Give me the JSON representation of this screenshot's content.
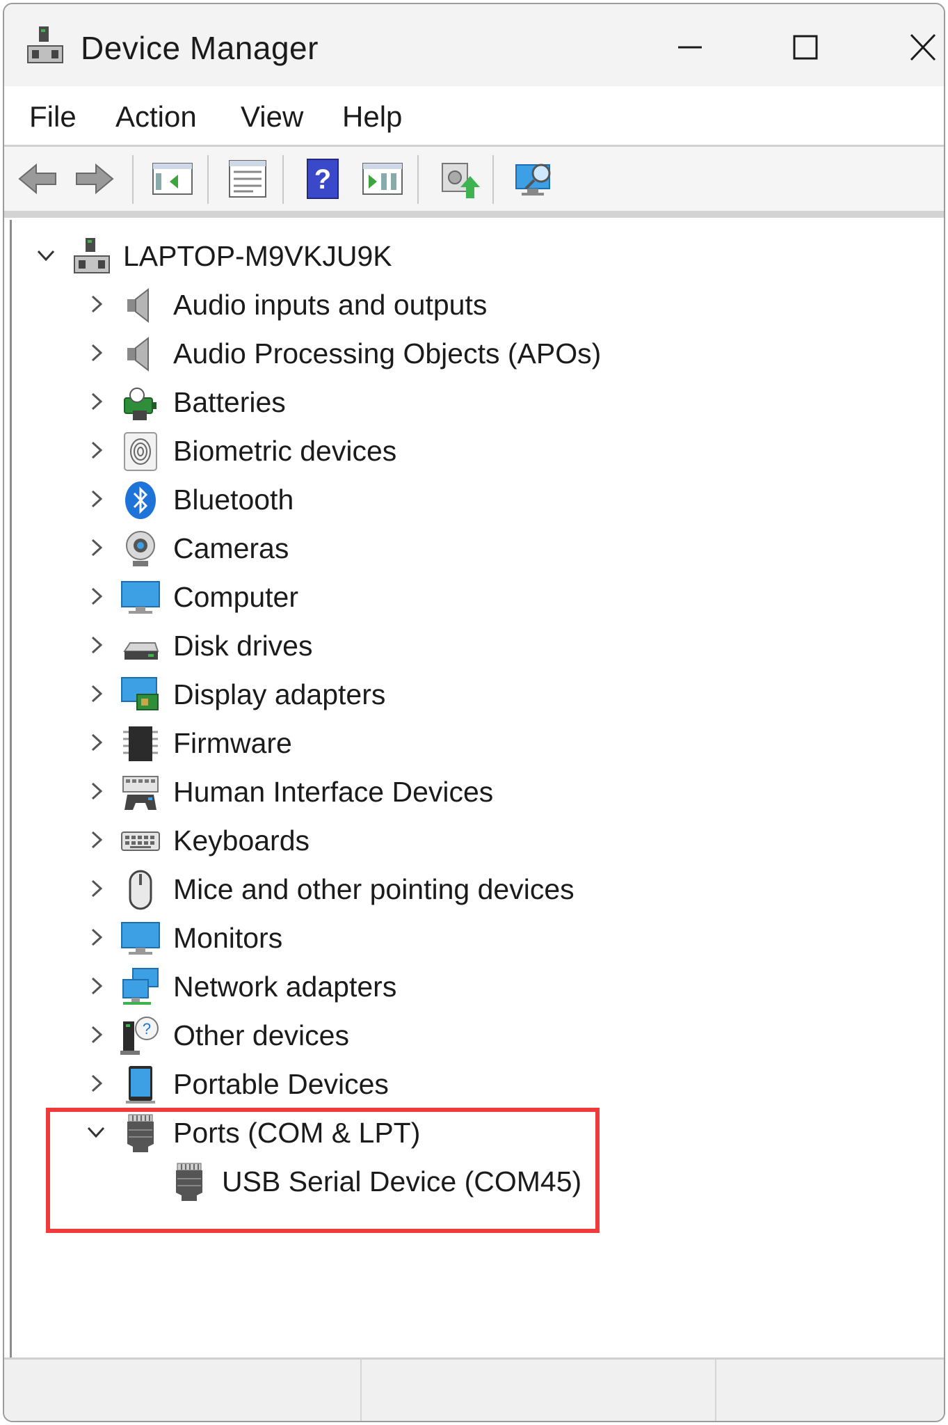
{
  "window": {
    "title": "Device Manager"
  },
  "menu": [
    "File",
    "Action",
    "View",
    "Help"
  ],
  "toolbar_icons": [
    "back-arrow-icon",
    "forward-arrow-icon",
    "show-hide-console-tree-icon",
    "properties-icon",
    "help-icon",
    "console-view-icon",
    "update-driver-icon",
    "scan-hardware-changes-icon"
  ],
  "tree": {
    "root": {
      "label": "LAPTOP-M9VKJU9K",
      "expanded": true
    },
    "categories": [
      {
        "label": "Audio inputs and outputs",
        "icon": "speaker-icon",
        "expanded": false
      },
      {
        "label": "Audio Processing Objects (APOs)",
        "icon": "speaker-icon",
        "expanded": false
      },
      {
        "label": "Batteries",
        "icon": "battery-icon",
        "expanded": false
      },
      {
        "label": "Biometric devices",
        "icon": "fingerprint-icon",
        "expanded": false
      },
      {
        "label": "Bluetooth",
        "icon": "bluetooth-icon",
        "expanded": false
      },
      {
        "label": "Cameras",
        "icon": "webcam-icon",
        "expanded": false
      },
      {
        "label": "Computer",
        "icon": "monitor-icon",
        "expanded": false
      },
      {
        "label": "Disk drives",
        "icon": "disk-drive-icon",
        "expanded": false
      },
      {
        "label": "Display adapters",
        "icon": "display-adapter-icon",
        "expanded": false
      },
      {
        "label": "Firmware",
        "icon": "chip-icon",
        "expanded": false
      },
      {
        "label": "Human Interface Devices",
        "icon": "hid-icon",
        "expanded": false
      },
      {
        "label": "Keyboards",
        "icon": "keyboard-icon",
        "expanded": false
      },
      {
        "label": "Mice and other pointing devices",
        "icon": "mouse-icon",
        "expanded": false
      },
      {
        "label": "Monitors",
        "icon": "monitor-icon",
        "expanded": false
      },
      {
        "label": "Network adapters",
        "icon": "network-icon",
        "expanded": false
      },
      {
        "label": "Other devices",
        "icon": "unknown-device-icon",
        "expanded": false
      },
      {
        "label": "Portable Devices",
        "icon": "portable-device-icon",
        "expanded": false
      },
      {
        "label": "Ports (COM & LPT)",
        "icon": "port-icon",
        "expanded": true,
        "children": [
          {
            "label": "USB Serial Device (COM45)",
            "icon": "port-icon"
          }
        ]
      }
    ]
  },
  "colors": {
    "highlight_border": "#ef3b3b",
    "accent_blue": "#1e73d8",
    "titlebar_bg": "#f3f3f3"
  }
}
